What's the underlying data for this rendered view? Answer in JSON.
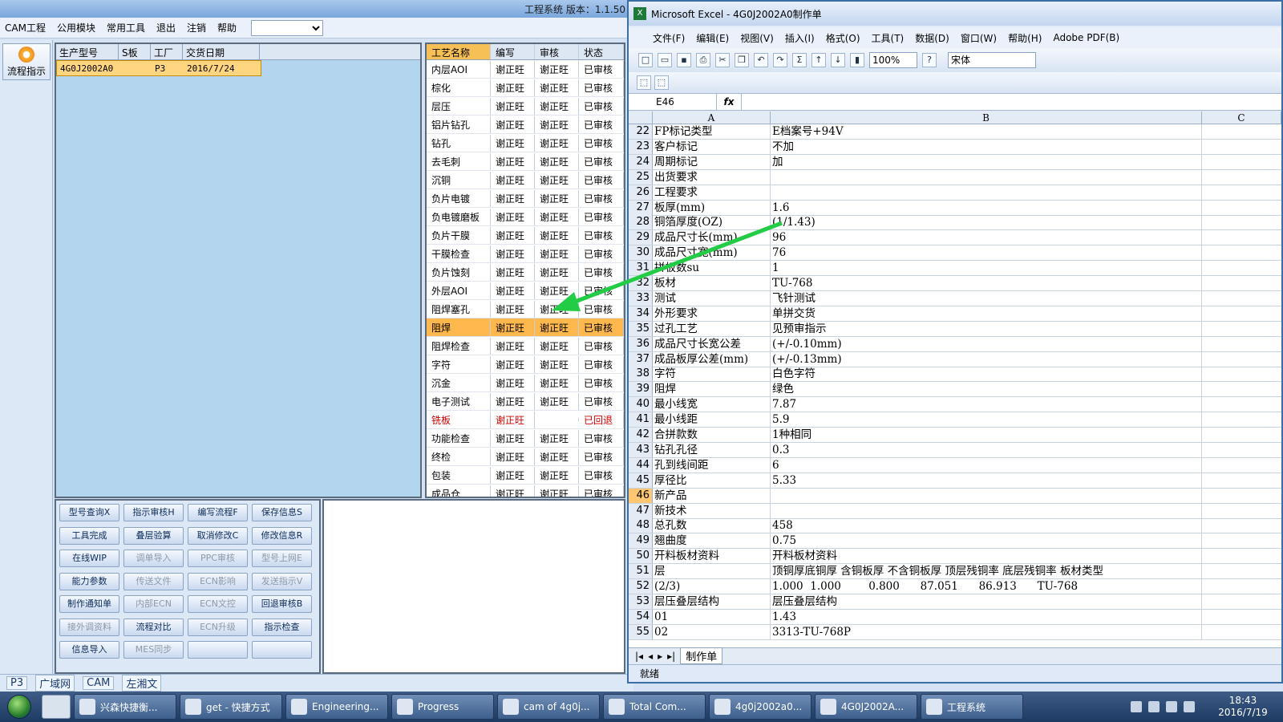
{
  "cam": {
    "title_right": "工程系统  版本：1.1.50",
    "menu": [
      "CAM工程",
      "公用模块",
      "常用工具",
      "退出",
      "注销",
      "帮助"
    ],
    "flow_btn": "流程指示",
    "grid1": {
      "headers": [
        "生产型号",
        "S板",
        "工厂",
        "交货日期"
      ],
      "row": [
        "4G0J2002A0",
        "",
        "P3",
        "2016/7/24"
      ]
    },
    "grid2": {
      "headers": [
        "工艺名称",
        "编写",
        "审核",
        "状态"
      ],
      "rows": [
        [
          "内层AOI",
          "谢正旺",
          "谢正旺",
          "已审核"
        ],
        [
          "棕化",
          "谢正旺",
          "谢正旺",
          "已审核"
        ],
        [
          "层压",
          "谢正旺",
          "谢正旺",
          "已审核"
        ],
        [
          "铝片钻孔",
          "谢正旺",
          "谢正旺",
          "已审核"
        ],
        [
          "钻孔",
          "谢正旺",
          "谢正旺",
          "已审核"
        ],
        [
          "去毛刺",
          "谢正旺",
          "谢正旺",
          "已审核"
        ],
        [
          "沉铜",
          "谢正旺",
          "谢正旺",
          "已审核"
        ],
        [
          "负片电镀",
          "谢正旺",
          "谢正旺",
          "已审核"
        ],
        [
          "负电镀磨板",
          "谢正旺",
          "谢正旺",
          "已审核"
        ],
        [
          "负片干膜",
          "谢正旺",
          "谢正旺",
          "已审核"
        ],
        [
          "干膜检查",
          "谢正旺",
          "谢正旺",
          "已审核"
        ],
        [
          "负片蚀刻",
          "谢正旺",
          "谢正旺",
          "已审核"
        ],
        [
          "外层AOI",
          "谢正旺",
          "谢正旺",
          "已审核"
        ],
        [
          "阻焊塞孔",
          "谢正旺",
          "谢正旺",
          "已审核"
        ],
        [
          "阻焊",
          "谢正旺",
          "谢正旺",
          "已审核"
        ],
        [
          "阻焊检查",
          "谢正旺",
          "谢正旺",
          "已审核"
        ],
        [
          "字符",
          "谢正旺",
          "谢正旺",
          "已审核"
        ],
        [
          "沉金",
          "谢正旺",
          "谢正旺",
          "已审核"
        ],
        [
          "电子测试",
          "谢正旺",
          "谢正旺",
          "已审核"
        ],
        [
          "铣板",
          "谢正旺",
          "",
          "已回退"
        ],
        [
          "功能检查",
          "谢正旺",
          "谢正旺",
          "已审核"
        ],
        [
          "终检",
          "谢正旺",
          "谢正旺",
          "已审核"
        ],
        [
          "包装",
          "谢正旺",
          "谢正旺",
          "已审核"
        ],
        [
          "成品仓",
          "谢正旺",
          "谢正旺",
          "已审核"
        ]
      ]
    },
    "buttons": [
      [
        "型号查询X",
        "指示审核H",
        "编写流程F",
        "保存信息S"
      ],
      [
        "工具完成",
        "叠层验算",
        "取消修改C",
        "修改信息R"
      ],
      [
        "在线WIP",
        "调单导入",
        "PPC审核",
        "型号上网E"
      ],
      [
        "能力参数",
        "传送文件",
        "ECN影响",
        "发送指示V"
      ],
      [
        "制作通知单",
        "内部ECN",
        "ECN文控",
        "回退审核B"
      ],
      [
        "接外调资料",
        "流程对比",
        "ECN升级",
        "指示检查"
      ],
      [
        "信息导入",
        "MES同步",
        "",
        ""
      ]
    ],
    "status": [
      "P3",
      "广域网",
      "CAM",
      "左湘文"
    ]
  },
  "excel": {
    "title": "Microsoft Excel - 4G0J2002A0制作单",
    "menu": [
      "文件(F)",
      "编辑(E)",
      "视图(V)",
      "插入(I)",
      "格式(O)",
      "工具(T)",
      "数据(D)",
      "窗口(W)",
      "帮助(H)",
      "Adobe PDF(B)"
    ],
    "zoom": "100%",
    "font": "宋体",
    "namebox": "E46",
    "fx": "fx",
    "columns": [
      "A",
      "B",
      "C"
    ],
    "rows": [
      [
        "22",
        "FP标记类型",
        "E档案号+94V"
      ],
      [
        "23",
        "客户标记",
        "不加"
      ],
      [
        "24",
        "周期标记",
        "加"
      ],
      [
        "25",
        "出货要求",
        ""
      ],
      [
        "26",
        "工程要求",
        ""
      ],
      [
        "27",
        "板厚(mm)",
        "1.6"
      ],
      [
        "28",
        "铜箔厚度(OZ)",
        "(1/1.43)"
      ],
      [
        "29",
        "成品尺寸长(mm)",
        "96"
      ],
      [
        "30",
        "成品尺寸宽(mm)",
        "76"
      ],
      [
        "31",
        "拼板数su",
        "1"
      ],
      [
        "32",
        "板材",
        "TU-768"
      ],
      [
        "33",
        "测试",
        "飞针测试"
      ],
      [
        "34",
        "外形要求",
        "单拼交货"
      ],
      [
        "35",
        "过孔工艺",
        "见预审指示"
      ],
      [
        "36",
        "成品尺寸长宽公差",
        "(+/-0.10mm)"
      ],
      [
        "37",
        "成品板厚公差(mm)",
        "(+/-0.13mm)"
      ],
      [
        "38",
        "字符",
        "白色字符"
      ],
      [
        "39",
        "阻焊",
        "绿色"
      ],
      [
        "40",
        "最小线宽",
        "7.87"
      ],
      [
        "41",
        "最小线距",
        "5.9"
      ],
      [
        "42",
        "合拼款数",
        "1种相同"
      ],
      [
        "43",
        "钻孔孔径",
        "0.3"
      ],
      [
        "44",
        "孔到线间距",
        "6"
      ],
      [
        "45",
        "厚径比",
        "5.33"
      ],
      [
        "46",
        "新产品",
        ""
      ],
      [
        "47",
        "新技术",
        ""
      ],
      [
        "48",
        "总孔数",
        "458"
      ],
      [
        "49",
        "翘曲度",
        "0.75"
      ],
      [
        "50",
        "开料板材资料",
        "开料板材资料"
      ],
      [
        "51",
        "层",
        "顶铜厚底铜厚 含铜板厚 不含铜板厚 顶层残铜率 底层残铜率 板材类型"
      ],
      [
        "52",
        "(2/3)",
        "1.000  1.000        0.800      87.051      86.913      TU-768"
      ],
      [
        "53",
        "层压叠层结构",
        "层压叠层结构"
      ],
      [
        "54",
        "01",
        "1.43"
      ],
      [
        "55",
        "02",
        "3313-TU-768P"
      ]
    ],
    "sheet_tab": "制作单",
    "status": "就绪"
  },
  "taskbar": {
    "tasks": [
      "兴森快捷衡...",
      "get - 快捷方式",
      "Engineering...",
      "Progress",
      "cam of 4g0j...",
      "Total Com...",
      "4g0j2002a0...",
      "4G0J2002A...",
      "工程系统"
    ],
    "time": "18:43",
    "date": "2016/7/19"
  },
  "colors": {
    "selection": "#ffb84d",
    "accent": "#3a6ea5",
    "arrow": "#22cc44",
    "returned": "#d20000"
  }
}
